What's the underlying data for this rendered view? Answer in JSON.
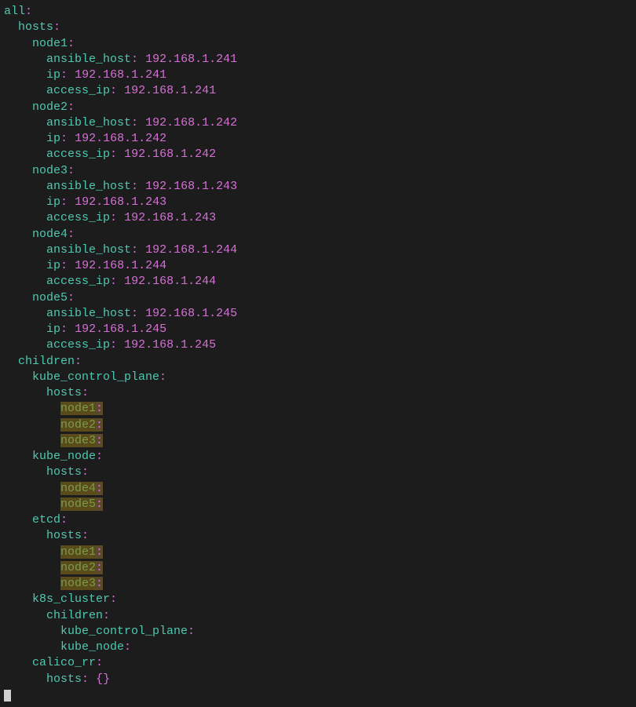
{
  "yaml": {
    "root_key": "all",
    "hosts_key": "hosts",
    "children_key": "children",
    "nodes": [
      {
        "name": "node1",
        "ansible_host_key": "ansible_host",
        "ansible_host": "192.168.1.241",
        "ip_key": "ip",
        "ip": "192.168.1.241",
        "access_ip_key": "access_ip",
        "access_ip": "192.168.1.241"
      },
      {
        "name": "node2",
        "ansible_host_key": "ansible_host",
        "ansible_host": "192.168.1.242",
        "ip_key": "ip",
        "ip": "192.168.1.242",
        "access_ip_key": "access_ip",
        "access_ip": "192.168.1.242"
      },
      {
        "name": "node3",
        "ansible_host_key": "ansible_host",
        "ansible_host": "192.168.1.243",
        "ip_key": "ip",
        "ip": "192.168.1.243",
        "access_ip_key": "access_ip",
        "access_ip": "192.168.1.243"
      },
      {
        "name": "node4",
        "ansible_host_key": "ansible_host",
        "ansible_host": "192.168.1.244",
        "ip_key": "ip",
        "ip": "192.168.1.244",
        "access_ip_key": "access_ip",
        "access_ip": "192.168.1.244"
      },
      {
        "name": "node5",
        "ansible_host_key": "ansible_host",
        "ansible_host": "192.168.1.245",
        "ip_key": "ip",
        "ip": "192.168.1.245",
        "access_ip_key": "access_ip",
        "access_ip": "192.168.1.245"
      }
    ],
    "children": {
      "kube_control_plane": {
        "key": "kube_control_plane",
        "hosts_key": "hosts",
        "nodes": [
          "node1",
          "node2",
          "node3"
        ]
      },
      "kube_node": {
        "key": "kube_node",
        "hosts_key": "hosts",
        "nodes": [
          "node4",
          "node5"
        ]
      },
      "etcd": {
        "key": "etcd",
        "hosts_key": "hosts",
        "nodes": [
          "node1",
          "node2",
          "node3"
        ]
      },
      "k8s_cluster": {
        "key": "k8s_cluster",
        "children_key": "children",
        "children": [
          "kube_control_plane",
          "kube_node"
        ]
      },
      "calico_rr": {
        "key": "calico_rr",
        "hosts_key": "hosts",
        "empty": "{}"
      }
    }
  }
}
